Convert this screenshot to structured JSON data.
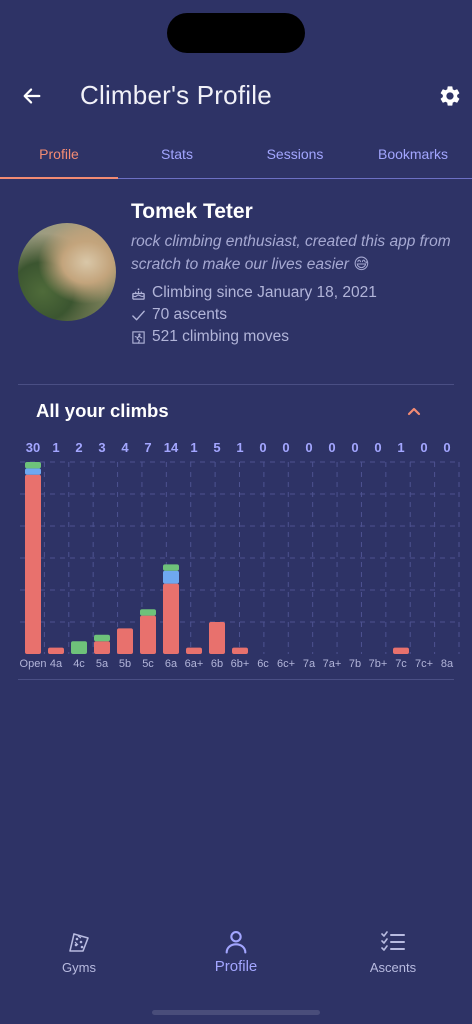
{
  "appbar": {
    "title": "Climber's Profile",
    "back_icon": "arrow-left-icon",
    "settings_icon": "gear-icon"
  },
  "tabs": [
    {
      "label": "Profile",
      "active": true
    },
    {
      "label": "Stats",
      "active": false
    },
    {
      "label": "Sessions",
      "active": false
    },
    {
      "label": "Bookmarks",
      "active": false
    }
  ],
  "profile": {
    "name": "Tomek Teter",
    "bio": "rock climbing enthusiast, created this app from scratch to make our lives easier 😅",
    "since": "Climbing since January 18, 2021",
    "ascents": "70 ascents",
    "moves": "521 climbing moves"
  },
  "section": {
    "title": "All your climbs",
    "expanded": true
  },
  "colors": {
    "background": "#2e3366",
    "accent": "#f38b73",
    "tab_inactive": "#a3a6ff",
    "bar_red": "#e8716d",
    "bar_blue": "#6fa8f0",
    "bar_green": "#6ec27a"
  },
  "chart_data": {
    "type": "bar",
    "stacked": true,
    "categories": [
      "Open",
      "4a",
      "4c",
      "5a",
      "5b",
      "5c",
      "6a",
      "6a+",
      "6b",
      "6b+",
      "6c",
      "6c+",
      "7a",
      "7a+",
      "7b",
      "7b+",
      "7c",
      "7c+",
      "8a"
    ],
    "totals": [
      "30",
      "1",
      "2",
      "3",
      "4",
      "7",
      "14",
      "1",
      "5",
      "1",
      "0",
      "0",
      "0",
      "0",
      "0",
      "0",
      "1",
      "0",
      "0"
    ],
    "series": [
      {
        "color": "#e8716d",
        "values": [
          28,
          1,
          0,
          2,
          4,
          6,
          11,
          1,
          5,
          1,
          0,
          0,
          0,
          0,
          0,
          0,
          1,
          0,
          0
        ]
      },
      {
        "color": "#6fa8f0",
        "values": [
          1,
          0,
          0,
          0,
          0,
          0,
          2,
          0,
          0,
          0,
          0,
          0,
          0,
          0,
          0,
          0,
          0,
          0,
          0
        ]
      },
      {
        "color": "#6ec27a",
        "values": [
          1,
          0,
          2,
          1,
          0,
          1,
          1,
          0,
          0,
          0,
          0,
          0,
          0,
          0,
          0,
          0,
          0,
          0,
          0
        ]
      }
    ],
    "ylim": [
      0,
      30
    ],
    "grid": true
  },
  "bottom_nav": [
    {
      "label": "Gyms",
      "icon": "climbing-wall-icon",
      "active": false
    },
    {
      "label": "Profile",
      "icon": "person-icon",
      "active": true
    },
    {
      "label": "Ascents",
      "icon": "checklist-icon",
      "active": false
    }
  ]
}
